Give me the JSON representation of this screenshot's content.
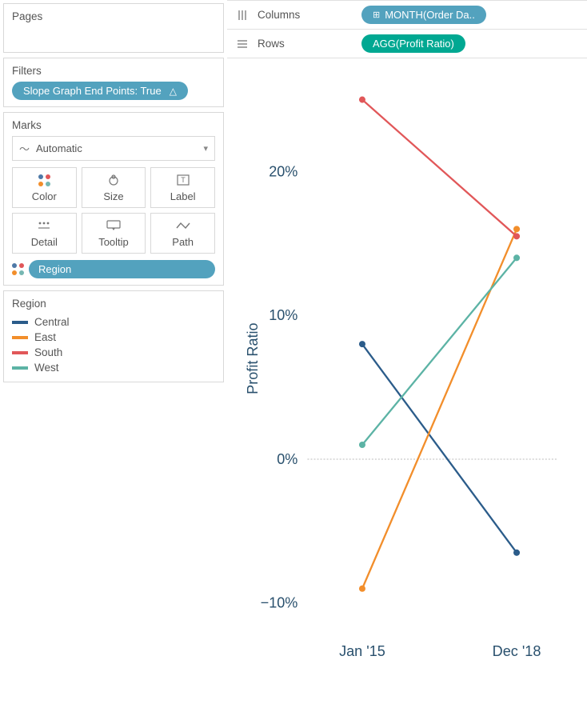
{
  "pages": {
    "title": "Pages"
  },
  "filters": {
    "title": "Filters",
    "pill": "Slope Graph End Points: True"
  },
  "marks": {
    "title": "Marks",
    "type": "Automatic",
    "cards": {
      "color": "Color",
      "size": "Size",
      "label": "Label",
      "detail": "Detail",
      "tooltip": "Tooltip",
      "path": "Path"
    },
    "region_pill": "Region"
  },
  "columns": {
    "label": "Columns",
    "pill": "MONTH(Order Da.."
  },
  "rows": {
    "label": "Rows",
    "pill": "AGG(Profit Ratio)"
  },
  "legend": {
    "title": "Region",
    "items": [
      {
        "name": "Central",
        "color": "#2b5c8a"
      },
      {
        "name": "East",
        "color": "#f28e2b"
      },
      {
        "name": "South",
        "color": "#e15759"
      },
      {
        "name": "West",
        "color": "#5cb3a5"
      }
    ]
  },
  "chart_data": {
    "type": "line",
    "title": "",
    "xlabel": "",
    "ylabel": "Profit Ratio",
    "ylim": [
      -12,
      26
    ],
    "yticks": [
      -10,
      0,
      10,
      20
    ],
    "ytick_labels": [
      "−10%",
      "0%",
      "10%",
      "20%"
    ],
    "categories": [
      "Jan '15",
      "Dec '18"
    ],
    "zero_line": 0,
    "series": [
      {
        "name": "Central",
        "color": "#2b5c8a",
        "values": [
          8,
          -6.5
        ]
      },
      {
        "name": "East",
        "color": "#f28e2b",
        "values": [
          -9,
          16
        ]
      },
      {
        "name": "South",
        "color": "#e15759",
        "values": [
          25,
          15.5
        ]
      },
      {
        "name": "West",
        "color": "#5cb3a5",
        "values": [
          1,
          14
        ]
      }
    ]
  }
}
